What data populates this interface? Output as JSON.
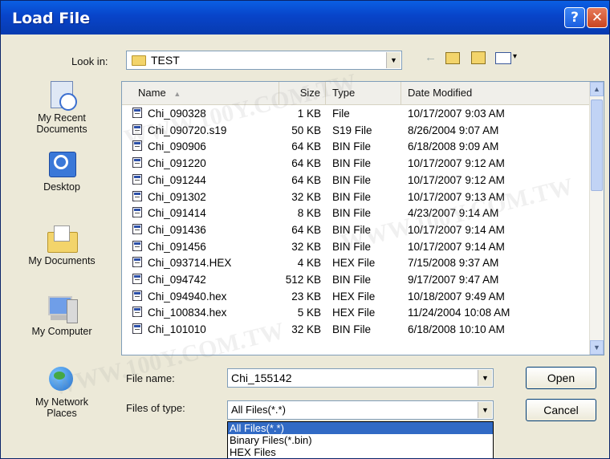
{
  "window": {
    "title": "Load File",
    "help_label": "?",
    "close_label": "✕"
  },
  "look_in": {
    "label": "Look in:",
    "value": "TEST"
  },
  "toolbar": {
    "icons": [
      "back-icon",
      "up-folder-icon",
      "new-folder-icon",
      "view-menu-icon"
    ]
  },
  "places": [
    {
      "label": "My Recent\nDocuments",
      "icon": "recent-documents-icon"
    },
    {
      "label": "Desktop",
      "icon": "desktop-icon"
    },
    {
      "label": "My Documents",
      "icon": "my-documents-icon"
    },
    {
      "label": "My Computer",
      "icon": "my-computer-icon"
    },
    {
      "label": "My Network\nPlaces",
      "icon": "network-places-icon"
    }
  ],
  "columns": [
    "Name",
    "Size",
    "Type",
    "Date Modified"
  ],
  "files": [
    {
      "name": "Chi_090328",
      "size": "1 KB",
      "type": "File",
      "date": "10/17/2007 9:03 AM"
    },
    {
      "name": "Chi_090720.s19",
      "size": "50 KB",
      "type": "S19 File",
      "date": "8/26/2004 9:07 AM"
    },
    {
      "name": "Chi_090906",
      "size": "64 KB",
      "type": "BIN File",
      "date": "6/18/2008 9:09 AM"
    },
    {
      "name": "Chi_091220",
      "size": "64 KB",
      "type": "BIN File",
      "date": "10/17/2007 9:12 AM"
    },
    {
      "name": "Chi_091244",
      "size": "64 KB",
      "type": "BIN File",
      "date": "10/17/2007 9:12 AM"
    },
    {
      "name": "Chi_091302",
      "size": "32 KB",
      "type": "BIN File",
      "date": "10/17/2007 9:13 AM"
    },
    {
      "name": "Chi_091414",
      "size": "8 KB",
      "type": "BIN File",
      "date": "4/23/2007 9:14 AM"
    },
    {
      "name": "Chi_091436",
      "size": "64 KB",
      "type": "BIN File",
      "date": "10/17/2007 9:14 AM"
    },
    {
      "name": "Chi_091456",
      "size": "32 KB",
      "type": "BIN File",
      "date": "10/17/2007 9:14 AM"
    },
    {
      "name": "Chi_093714.HEX",
      "size": "4 KB",
      "type": "HEX File",
      "date": "7/15/2008 9:37 AM"
    },
    {
      "name": "Chi_094742",
      "size": "512 KB",
      "type": "BIN File",
      "date": "9/17/2007 9:47 AM"
    },
    {
      "name": "Chi_094940.hex",
      "size": "23 KB",
      "type": "HEX File",
      "date": "10/18/2007 9:49 AM"
    },
    {
      "name": "Chi_100834.hex",
      "size": "5 KB",
      "type": "HEX File",
      "date": "11/24/2004 10:08 AM"
    },
    {
      "name": "Chi_101010",
      "size": "32 KB",
      "type": "BIN File",
      "date": "6/18/2008 10:10 AM"
    }
  ],
  "file_name": {
    "label": "File name:",
    "value": "Chi_155142"
  },
  "files_of_type": {
    "label": "Files of type:",
    "value": "All Files(*.*)",
    "options": [
      "All Files(*.*)",
      "Binary Files(*.bin)",
      "HEX Files"
    ]
  },
  "buttons": {
    "open": "Open",
    "cancel": "Cancel"
  },
  "watermark": "WWW.100Y.COM.TW",
  "colors": {
    "title_bar": "#0a5fe3",
    "selection": "#316ac5",
    "dialog_bg": "#ece9d8"
  }
}
